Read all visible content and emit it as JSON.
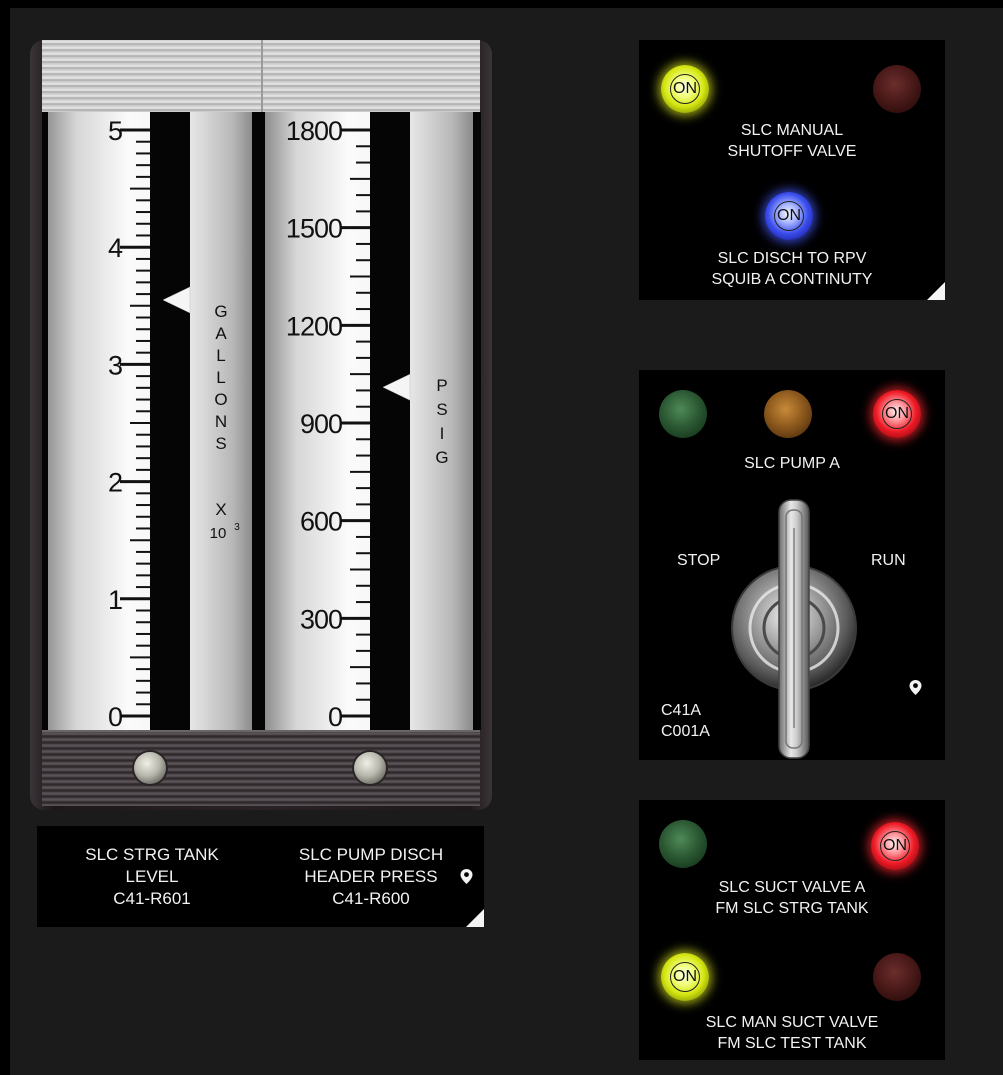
{
  "meters": {
    "tank_level": {
      "scale_labels": [
        "0",
        "1",
        "2",
        "3",
        "4",
        "5"
      ],
      "unit_letters": [
        "G",
        "A",
        "L",
        "L",
        "O",
        "N",
        "S"
      ],
      "multiplier_x": "X",
      "multiplier_base": "10",
      "multiplier_exp": "3",
      "indicated_value": 3.55,
      "range": [
        0,
        5
      ]
    },
    "pump_pressure": {
      "scale_labels": [
        "0",
        "300",
        "600",
        "900",
        "1200",
        "1500",
        "1800"
      ],
      "unit_letters": [
        "P",
        "S",
        "I",
        "G"
      ],
      "indicated_value": 1010,
      "range": [
        0,
        1800
      ]
    },
    "labels": {
      "left": [
        "SLC STRG TANK",
        "LEVEL",
        "C41-R601"
      ],
      "right": [
        "SLC PUMP DISCH",
        "HEADER PRESS",
        "C41-R600"
      ]
    }
  },
  "manual_shutoff_box": {
    "lamp_on_label": "ON",
    "valve_label": [
      "SLC MANUAL",
      "SHUTOFF VALVE"
    ],
    "squib_lamp_label": "ON",
    "squib_label": [
      "SLC DISCH TO RPV",
      "SQUIB A CONTINUTY"
    ]
  },
  "pump_box": {
    "red_lamp_label": "ON",
    "title": "SLC PUMP A",
    "stop_label": "STOP",
    "run_label": "RUN",
    "id_label": [
      "C41A",
      "C001A"
    ]
  },
  "suction_box": {
    "red_lamp_label": "ON",
    "suct_valve_label": [
      "SLC SUCT VALVE A",
      "FM SLC STRG TANK"
    ],
    "yellow_lamp_label": "ON",
    "man_suct_label": [
      "SLC MAN SUCT VALVE",
      "FM SLC TEST TANK"
    ]
  }
}
